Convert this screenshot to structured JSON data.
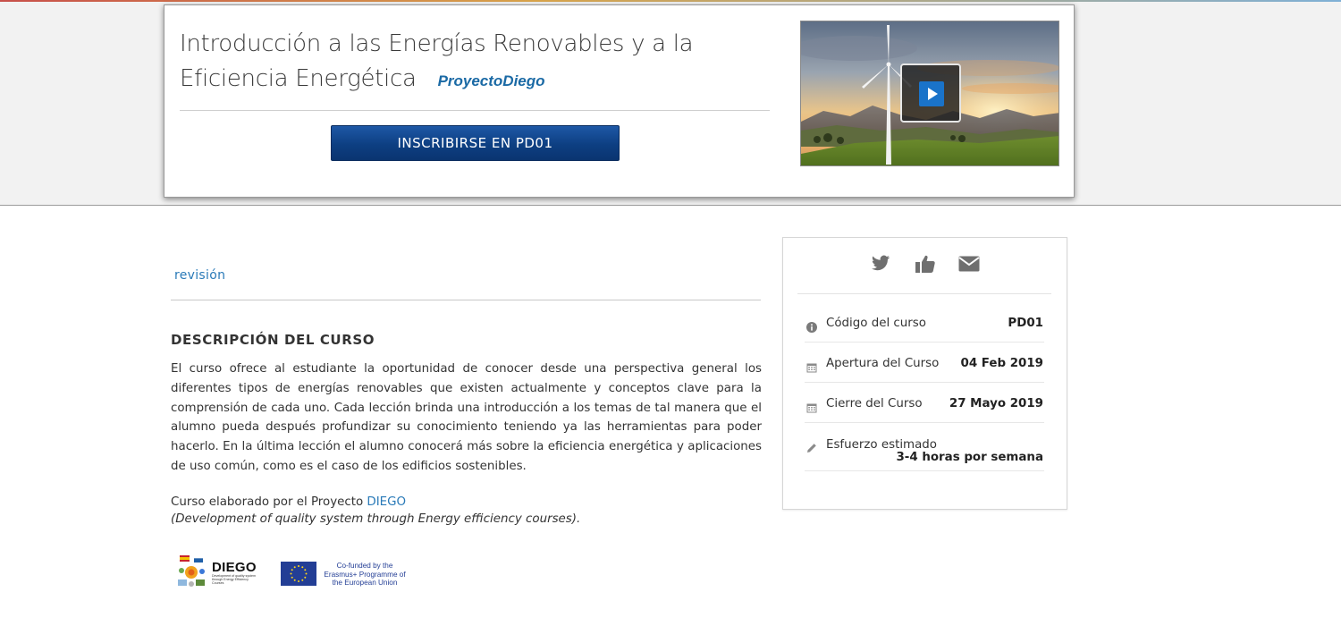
{
  "hero": {
    "title": "Introducción a las Energías Renovables y a la Eficiencia Energética",
    "organization": "ProyectoDiego",
    "enroll_label": "INSCRIBIRSE EN PD01",
    "video": {
      "play_icon": "play-icon"
    }
  },
  "main": {
    "review_link": "revisión",
    "section_heading": "DESCRIPCIÓN DEL CURSO",
    "description": "El curso ofrece al estudiante la oportunidad de conocer desde una perspectiva general los diferentes tipos de energías renovables que existen actualmente y conceptos clave para la comprensión de cada uno. Cada lección brinda una introducción a los temas de tal manera que el alumno pueda después profundizar su conocimiento teniendo ya las herramientas para poder hacerlo. En la última lección el alumno conocerá más sobre la eficiencia energética y aplicaciones de uso común, como es el caso de los edificios sostenibles.",
    "credit_prefix": "Curso elaborado por el Proyecto ",
    "credit_link": "DIEGO",
    "credit_italic": "(Development of quality system through Energy efficiency courses).",
    "logos": {
      "diego_word": "DIEGO",
      "diego_sub": "Development of quality system through Energy Efficiency Courses",
      "eu_text": "Co-funded by the Erasmus+ Programme of the European Union"
    }
  },
  "sidebar": {
    "share_icons": [
      "twitter-icon",
      "thumbs-up-icon",
      "envelope-icon"
    ],
    "rows": [
      {
        "icon": "info-icon",
        "label": "Código del curso",
        "value": "PD01"
      },
      {
        "icon": "calendar-icon",
        "label": "Apertura del Curso",
        "value": "04 Feb 2019"
      },
      {
        "icon": "calendar-icon",
        "label": "Cierre del Curso",
        "value": "27 Mayo 2019"
      },
      {
        "icon": "pencil-icon",
        "label": "Esfuerzo estimado",
        "value": "3-4 horas por semana"
      }
    ]
  },
  "colors": {
    "accent_link": "#2a7ab8",
    "button_blue": "#0d3f82",
    "org_blue": "#1b6aa5",
    "eu_blue": "#233e95"
  }
}
